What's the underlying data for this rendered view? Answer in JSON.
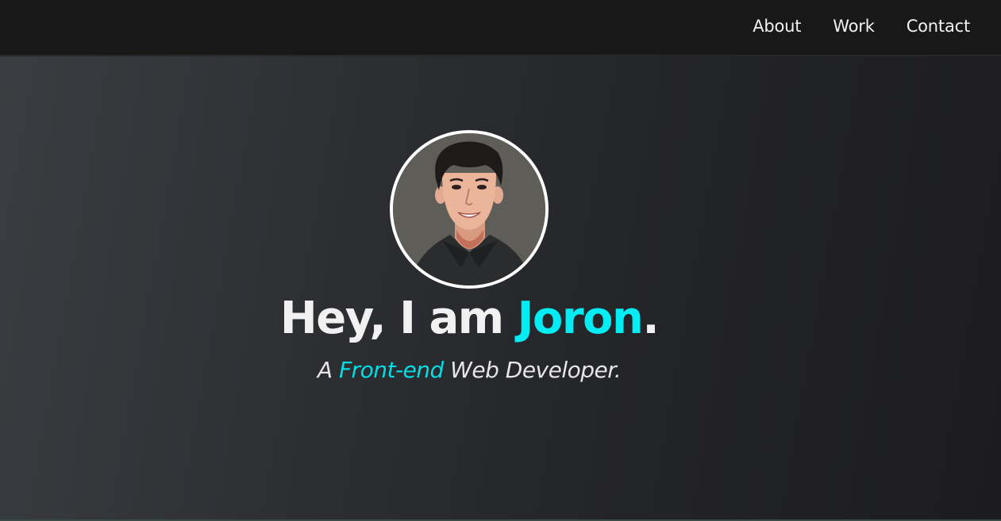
{
  "nav": {
    "links": [
      {
        "label": "About"
      },
      {
        "label": "Work"
      },
      {
        "label": "Contact"
      }
    ]
  },
  "hero": {
    "avatar_icon": "portrait-illustration",
    "headline": {
      "prefix": "Hey, I am ",
      "name": "Joron",
      "suffix": "."
    },
    "subline": {
      "prefix": "A ",
      "highlight": "Front-end",
      "suffix": " Web Developer."
    }
  },
  "colors": {
    "accent": "#00eef3",
    "nav_bg": "#181818",
    "text": "#f1f1f1"
  }
}
